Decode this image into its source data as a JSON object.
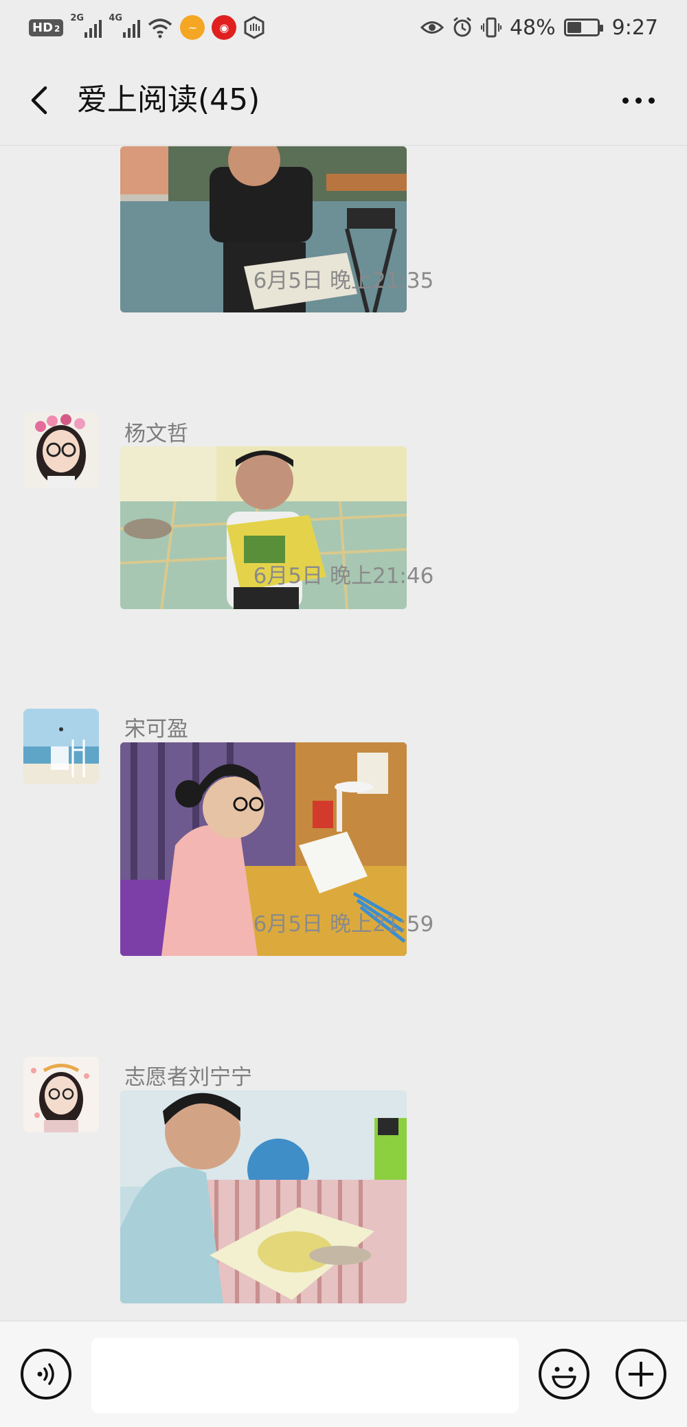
{
  "status_bar": {
    "hd_label": "HD",
    "sim2_label": "2",
    "network_2g": "2G",
    "network_4g": "4G",
    "battery_percent": "48%",
    "battery_level": 0.48,
    "time": "9:27"
  },
  "header": {
    "title": "爱上阅读(45)"
  },
  "messages": [
    {
      "type": "timestamp",
      "text": "6月5日 晚上21:35"
    },
    {
      "type": "image",
      "sender": "杨文哲"
    },
    {
      "type": "timestamp",
      "text": "6月5日 晚上21:46"
    },
    {
      "type": "image",
      "sender": "宋可盈"
    },
    {
      "type": "timestamp",
      "text": "6月5日 晚上21:59"
    },
    {
      "type": "image",
      "sender": "志愿者刘宁宁"
    }
  ],
  "input_bar": {
    "text_value": ""
  },
  "colors": {
    "background": "#ededed",
    "input_bar_bg": "#f6f6f6",
    "timestamp_text": "#8a8a8a",
    "sender_text": "#7d7d7d"
  },
  "icons": [
    "back-arrow-icon",
    "more-icon",
    "voice-icon",
    "emoji-icon",
    "plus-icon"
  ]
}
